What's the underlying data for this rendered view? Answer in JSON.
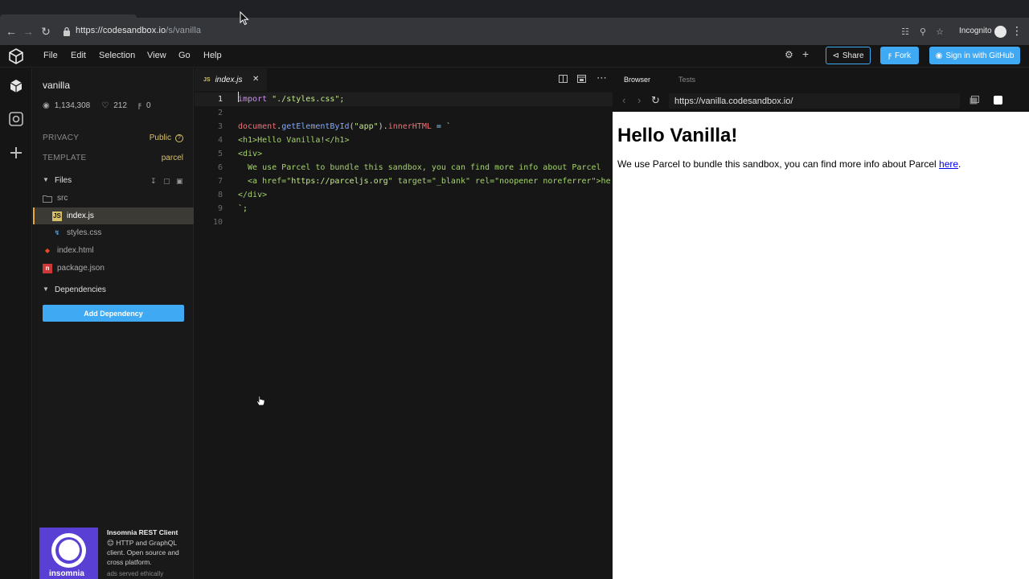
{
  "browser": {
    "url_host": "https://codesandbox.io",
    "url_path": "/s/vanilla",
    "profile_label": "Incognito"
  },
  "menu": {
    "items": [
      "File",
      "Edit",
      "Selection",
      "View",
      "Go",
      "Help"
    ],
    "share_label": "Share",
    "fork_label": "Fork",
    "signin_label": "Sign in with GitHub"
  },
  "sidebar": {
    "title": "vanilla",
    "views": "1,134,308",
    "likes": "212",
    "forks": "0",
    "privacy_label": "PRIVACY",
    "privacy_value": "Public",
    "template_label": "TEMPLATE",
    "template_value": "parcel",
    "files_label": "Files",
    "files": [
      {
        "name": "src",
        "type": "folder"
      },
      {
        "name": "index.js",
        "type": "js"
      },
      {
        "name": "styles.css",
        "type": "css"
      },
      {
        "name": "index.html",
        "type": "html"
      },
      {
        "name": "package.json",
        "type": "json"
      }
    ],
    "dependencies_label": "Dependencies",
    "add_dependency_label": "Add Dependency"
  },
  "ad": {
    "image_word": "insomnia",
    "title": "Insomnia REST Client",
    "body": "😊 HTTP and GraphQL client. Open source and cross platform.",
    "footer": "ads served ethically"
  },
  "editor": {
    "tab_badge": "JS",
    "tab_name": "index.js",
    "line_numbers": [
      "1",
      "2",
      "3",
      "4",
      "5",
      "6",
      "7",
      "8",
      "9",
      "10"
    ],
    "lines": [
      [
        {
          "t": "import",
          "c": "kw"
        },
        {
          "t": " \"./styles.css\";",
          "c": "str"
        }
      ],
      [],
      [
        {
          "t": "document",
          "c": "prop"
        },
        {
          "t": ".",
          "c": "plain"
        },
        {
          "t": "getElementById",
          "c": "fn"
        },
        {
          "t": "(",
          "c": "plain"
        },
        {
          "t": "\"app\"",
          "c": "str"
        },
        {
          "t": ").",
          "c": "plain"
        },
        {
          "t": "innerHTML",
          "c": "prop"
        },
        {
          "t": " = ",
          "c": "op"
        },
        {
          "t": "`",
          "c": "str"
        }
      ],
      [
        {
          "t": "<h1>Hello Vanilla!</h1>",
          "c": "tag"
        }
      ],
      [
        {
          "t": "<div>",
          "c": "tag"
        }
      ],
      [
        {
          "t": "  We use Parcel to bundle this sandbox, you can find more info about Parcel",
          "c": "txt"
        }
      ],
      [
        {
          "t": "  <a href=\"",
          "c": "tag"
        },
        {
          "t": "https://parceljs.org",
          "c": "attr"
        },
        {
          "t": "\" target=\"_blank\" rel=\"noopener noreferrer\">he",
          "c": "tag"
        }
      ],
      [
        {
          "t": "</div>",
          "c": "tag"
        }
      ],
      [
        {
          "t": "`;",
          "c": "str"
        }
      ],
      []
    ]
  },
  "preview": {
    "tab_browser": "Browser",
    "tab_tests": "Tests",
    "url": "https://vanilla.codesandbox.io/",
    "heading": "Hello Vanilla!",
    "paragraph": "We use Parcel to bundle this sandbox, you can find more info about Parcel ",
    "link_text": "here",
    "paragraph_end": "."
  }
}
